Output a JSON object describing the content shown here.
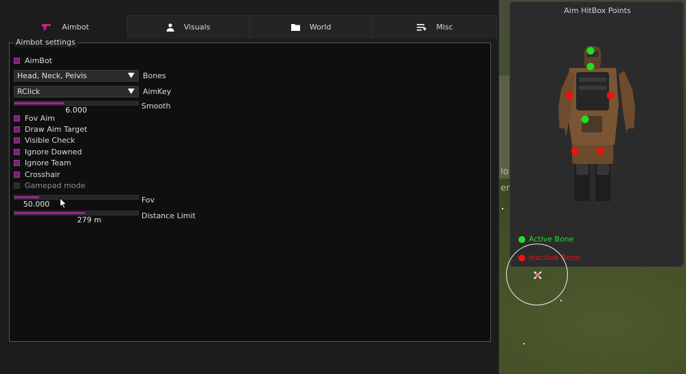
{
  "tabs": [
    {
      "label": "Aimbot",
      "icon": "pistol-icon",
      "active": true
    },
    {
      "label": "Visuals",
      "icon": "person-icon",
      "active": false
    },
    {
      "label": "World",
      "icon": "folder-icon",
      "active": false
    },
    {
      "label": "Misc",
      "icon": "list-settings-icon",
      "active": false
    }
  ],
  "group_title": "Aimbot settings",
  "aimbot_toggle": {
    "label": "AimBot",
    "checked": true
  },
  "bones": {
    "value": "Head, Neck, Pelvis",
    "label": "Bones"
  },
  "aimkey": {
    "value": "RClick",
    "label": "AimKey"
  },
  "smooth": {
    "value": "6.000",
    "label": "Smooth",
    "fraction": 0.4
  },
  "checkboxes": [
    {
      "label": "Fov Aim",
      "checked": true
    },
    {
      "label": "Draw Aim Target",
      "checked": true
    },
    {
      "label": "Visible Check",
      "checked": true
    },
    {
      "label": "Ignore Downed",
      "checked": true
    },
    {
      "label": "Ignore Team",
      "checked": true
    },
    {
      "label": "Crosshair",
      "checked": true
    },
    {
      "label": "Gamepad mode",
      "checked": false
    }
  ],
  "fov": {
    "value": "50.000",
    "label": "Fov",
    "fraction": 0.2
  },
  "distance": {
    "value": "279 m",
    "label": "Distance Limit",
    "fraction": 0.57
  },
  "hitbox_panel": {
    "title": "Aim HitBox Points",
    "legend_active": "Active Bone",
    "legend_inactive": "Inactive Bone",
    "active_color": "#22dd22",
    "inactive_color": "#ee1111"
  },
  "background_text": [
    "lo",
    "en"
  ],
  "colors": {
    "accent": "#a0239b",
    "panel_bg": "#1c1c1c",
    "group_bg": "#0f0f0f"
  }
}
